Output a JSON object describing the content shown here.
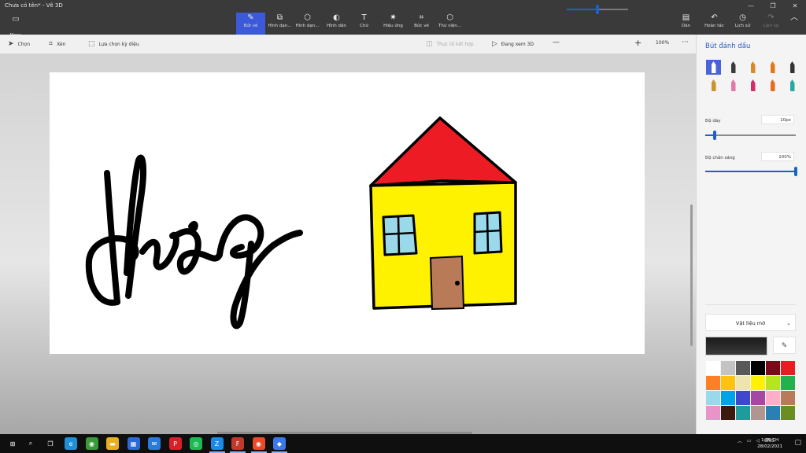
{
  "window": {
    "title": "Chưa có tên* - Vẽ 3D",
    "controls": [
      "—",
      "❐",
      "✕"
    ]
  },
  "ribbon": {
    "menu_label": "Menu",
    "tabs": [
      {
        "label": "Bút vẽ",
        "icon": "✎",
        "active": true
      },
      {
        "label": "Hình dạn...",
        "icon": "⧉"
      },
      {
        "label": "Hình dạn...",
        "icon": "⬡"
      },
      {
        "label": "Hình dán",
        "icon": "◐"
      },
      {
        "label": "Chữ",
        "icon": "T"
      },
      {
        "label": "Hiệu ứng",
        "icon": "✷"
      },
      {
        "label": "Bức vẽ",
        "icon": "⌗"
      },
      {
        "label": "Thư viện...",
        "icon": "⬡"
      }
    ],
    "right": [
      {
        "label": "Dán",
        "icon": "📋"
      },
      {
        "label": "Hoàn tác",
        "icon": "↶"
      },
      {
        "label": "Lịch sử",
        "icon": "◷"
      },
      {
        "label": "Làm lại",
        "icon": "↷",
        "disabled": true
      },
      {
        "label": "",
        "icon": "︿"
      }
    ]
  },
  "toolbar": {
    "select": "Chọn",
    "crop": "Xén",
    "magic_select": "Lựa chọn kỳ diệu",
    "mixed_reality": "Thực tế kết hợp",
    "view3d": "Đang xem 3D",
    "zoom_out": "—",
    "zoom_in": "+",
    "zoom_value": "100%",
    "more": "···",
    "zoom_fraction": 0.5
  },
  "panel": {
    "title": "Bút đánh dấu",
    "brushes": [
      {
        "name": "marker",
        "color": "#222"
      },
      {
        "name": "calligraphy-pen",
        "color": "#3a3a3a"
      },
      {
        "name": "oil-brush",
        "color": "#d88a2a"
      },
      {
        "name": "watercolor",
        "color": "#e07a18"
      },
      {
        "name": "pixel-pen",
        "color": "#333"
      },
      {
        "name": "pencil",
        "color": "#c8952a"
      },
      {
        "name": "eraser",
        "color": "#e27aa8"
      },
      {
        "name": "crayon",
        "color": "#d22c6a"
      },
      {
        "name": "spray-can",
        "color": "#e86a1c"
      },
      {
        "name": "fill-bucket",
        "color": "#2aa8a0"
      }
    ],
    "thickness_label": "Độ dày",
    "thickness_value": "10px",
    "thickness_fraction": 0.1,
    "opacity_label": "Độ chắn sáng",
    "opacity_value": "100%",
    "opacity_fraction": 1.0,
    "material": "Vật liệu mờ",
    "current_color": "#1a1a1a",
    "palette": [
      "#ffffff",
      "#c3c3c3",
      "#585858",
      "#000000",
      "#7a0a1a",
      "#e81c23",
      "#ff7f27",
      "#ffc20e",
      "#efe4b0",
      "#fff200",
      "#b5e61d",
      "#22b14c",
      "#99d9ea",
      "#00a2e8",
      "#3f48cc",
      "#a349a4",
      "#ffaec9",
      "#b97a57",
      "#e994c8",
      "#3c1a10",
      "#1e9c9c",
      "#b09690",
      "#2a7fb3",
      "#6b8e23"
    ]
  },
  "canvas": {
    "house_wall": "#fff200",
    "house_roof": "#ed1c24",
    "window_glass": "#99d9ea",
    "door": "#b97a57",
    "stroke": "#000000"
  },
  "taskbar": {
    "tray_lang": "ENG",
    "time": "1:05 CH",
    "date": "28/02/2021",
    "apps": [
      {
        "name": "edge",
        "color": "#1f8fd6",
        "glyph": "e"
      },
      {
        "name": "chrome-dev",
        "color": "#3a9a3a",
        "glyph": "◉"
      },
      {
        "name": "file-explorer",
        "color": "#e8b020",
        "glyph": "▬"
      },
      {
        "name": "store",
        "color": "#2a6ad8",
        "glyph": "▦"
      },
      {
        "name": "mail",
        "color": "#2a7ad8",
        "glyph": "✉"
      },
      {
        "name": "pinterest",
        "color": "#d8202a",
        "glyph": "P"
      },
      {
        "name": "spotify",
        "color": "#1db954",
        "glyph": "◎"
      },
      {
        "name": "zalo",
        "color": "#1a8ae8",
        "glyph": "Z"
      },
      {
        "name": "filezilla",
        "color": "#c0392b",
        "glyph": "F"
      },
      {
        "name": "chrome",
        "color": "#e84a2a",
        "glyph": "◉"
      },
      {
        "name": "paint-3d",
        "color": "#3a7ae8",
        "glyph": "◆"
      }
    ]
  }
}
